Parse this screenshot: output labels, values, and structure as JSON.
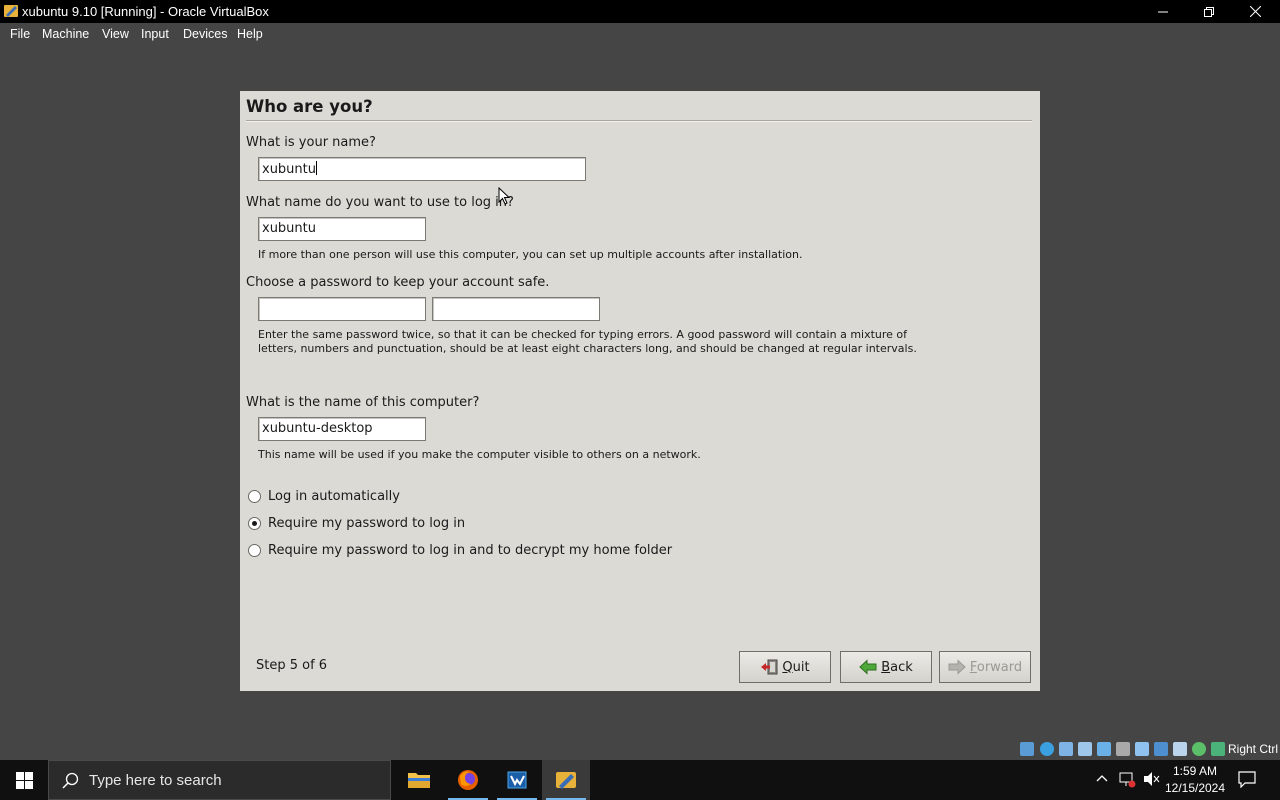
{
  "window": {
    "title": "xubuntu 9.10 [Running] - Oracle VirtualBox",
    "minimize_glyph": "—",
    "restore_glyph": "❐",
    "close_glyph": "✕"
  },
  "menubar": [
    "File",
    "Machine",
    "View",
    "Input",
    "Devices",
    "Help"
  ],
  "installer": {
    "heading": "Who are you?",
    "name_question": "What is your name?",
    "name_value": "xubuntu",
    "login_question": "What name do you want to use to log in?",
    "login_value": "xubuntu",
    "login_hint": "If more than one person will use this computer, you can set up multiple accounts after installation.",
    "password_question": "Choose a password to keep your account safe.",
    "password_value": "",
    "password_confirm_value": "",
    "password_hint": "Enter the same password twice, so that it can be checked for typing errors. A good password will contain a mixture of letters, numbers and punctuation, should be at least eight characters long, and should be changed at regular intervals.",
    "computer_question": "What is the name of this computer?",
    "computer_value": "xubuntu-desktop",
    "computer_hint": "This name will be used if you make the computer visible to others on a network.",
    "login_options": [
      {
        "label": "Log in automatically",
        "selected": false
      },
      {
        "label": "Require my password to log in",
        "selected": true
      },
      {
        "label": "Require my password to log in and to decrypt my home folder",
        "selected": false
      }
    ],
    "step": "Step 5 of 6",
    "buttons": {
      "quit_first": "Q",
      "quit_rest": "uit",
      "back_first": "B",
      "back_rest": "ack",
      "forward_first": "F",
      "forward_rest": "orward",
      "forward_enabled": false
    }
  },
  "statusbar": {
    "right_ctrl": "Right Ctrl"
  },
  "taskbar": {
    "search_placeholder": "Type here to search",
    "time": "1:59 AM",
    "date": "12/15/2024"
  },
  "colors": {
    "dialog_bg": "#dcdad5",
    "taskbar_accent": "#76b9ed"
  }
}
